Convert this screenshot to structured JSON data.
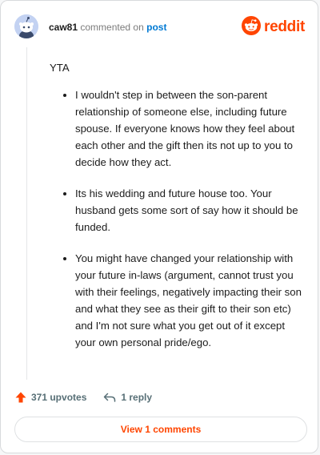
{
  "comment": {
    "username": "caw81",
    "verb": "commented on",
    "post_link": "post",
    "brand": "reddit",
    "opening": "YTA",
    "points": [
      "I wouldn't step in between the son-parent relationship of someone else, including future spouse. If everyone knows how they feel about each other and the gift then its not up to you to decide how they act.",
      "Its his wedding and future house too. Your husband gets some sort of say how it should be funded.",
      "You might have changed your relationship with your future in-laws (argument, cannot trust you with their feelings, negatively impacting their son and what they see as their gift to their son etc) and I'm not sure what you get out of it except your own personal pride/ego."
    ]
  },
  "actions": {
    "upvotes_label": "371 upvotes",
    "reply_label": "1 reply"
  },
  "footer": {
    "view_comments_label": "View 1 comments"
  },
  "colors": {
    "accent": "#ff4500",
    "link": "#0079d3",
    "text": "#1c1c1c",
    "muted": "#576f76"
  },
  "icons": {
    "avatar": "snoo-avatar-icon",
    "logo": "reddit-logo-icon",
    "upvote": "upvote-arrow-icon",
    "reply": "reply-arrow-icon"
  }
}
